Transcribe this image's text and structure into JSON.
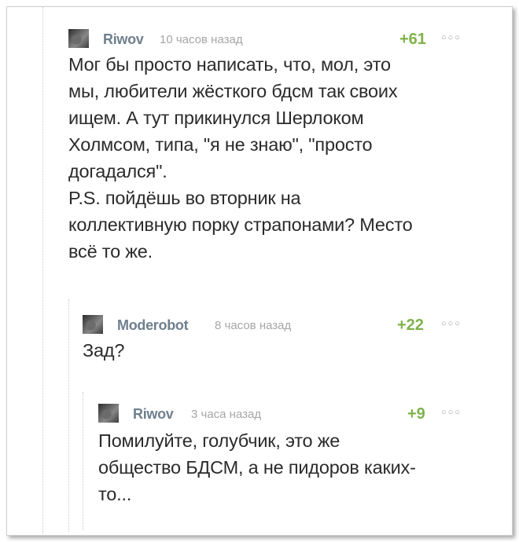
{
  "comments": [
    {
      "author": "Riwov",
      "time": "10 часов назад",
      "rating": "+61",
      "menu_icon": "more-dots-icon",
      "text": "Мог бы просто написать, что, мол, это\nмы, любители жёсткого бдсм так своих\nищем. А тут прикинулся Шерлоком\nХолмсом, типа, \"я не знаю\", \"просто\nдогадался\".\nP.S. пойдёшь во вторник на\nколлективную порку страпонами? Место\nвсё то же."
    },
    {
      "author": "Moderobot",
      "time": "8 часов назад",
      "rating": "+22",
      "menu_icon": "more-dots-icon",
      "text": "Зад?"
    },
    {
      "author": "Riwov",
      "time": "3 часа назад",
      "rating": "+9",
      "menu_icon": "more-dots-icon",
      "text": "Помилуйте, голубчик, это же\nобщество БДСМ, а не пидоров каких-\nто..."
    }
  ],
  "colors": {
    "author": "#6f7f8e",
    "time": "#a6a6a6",
    "rating": "#7fb24a",
    "text": "#2b2b2b"
  }
}
